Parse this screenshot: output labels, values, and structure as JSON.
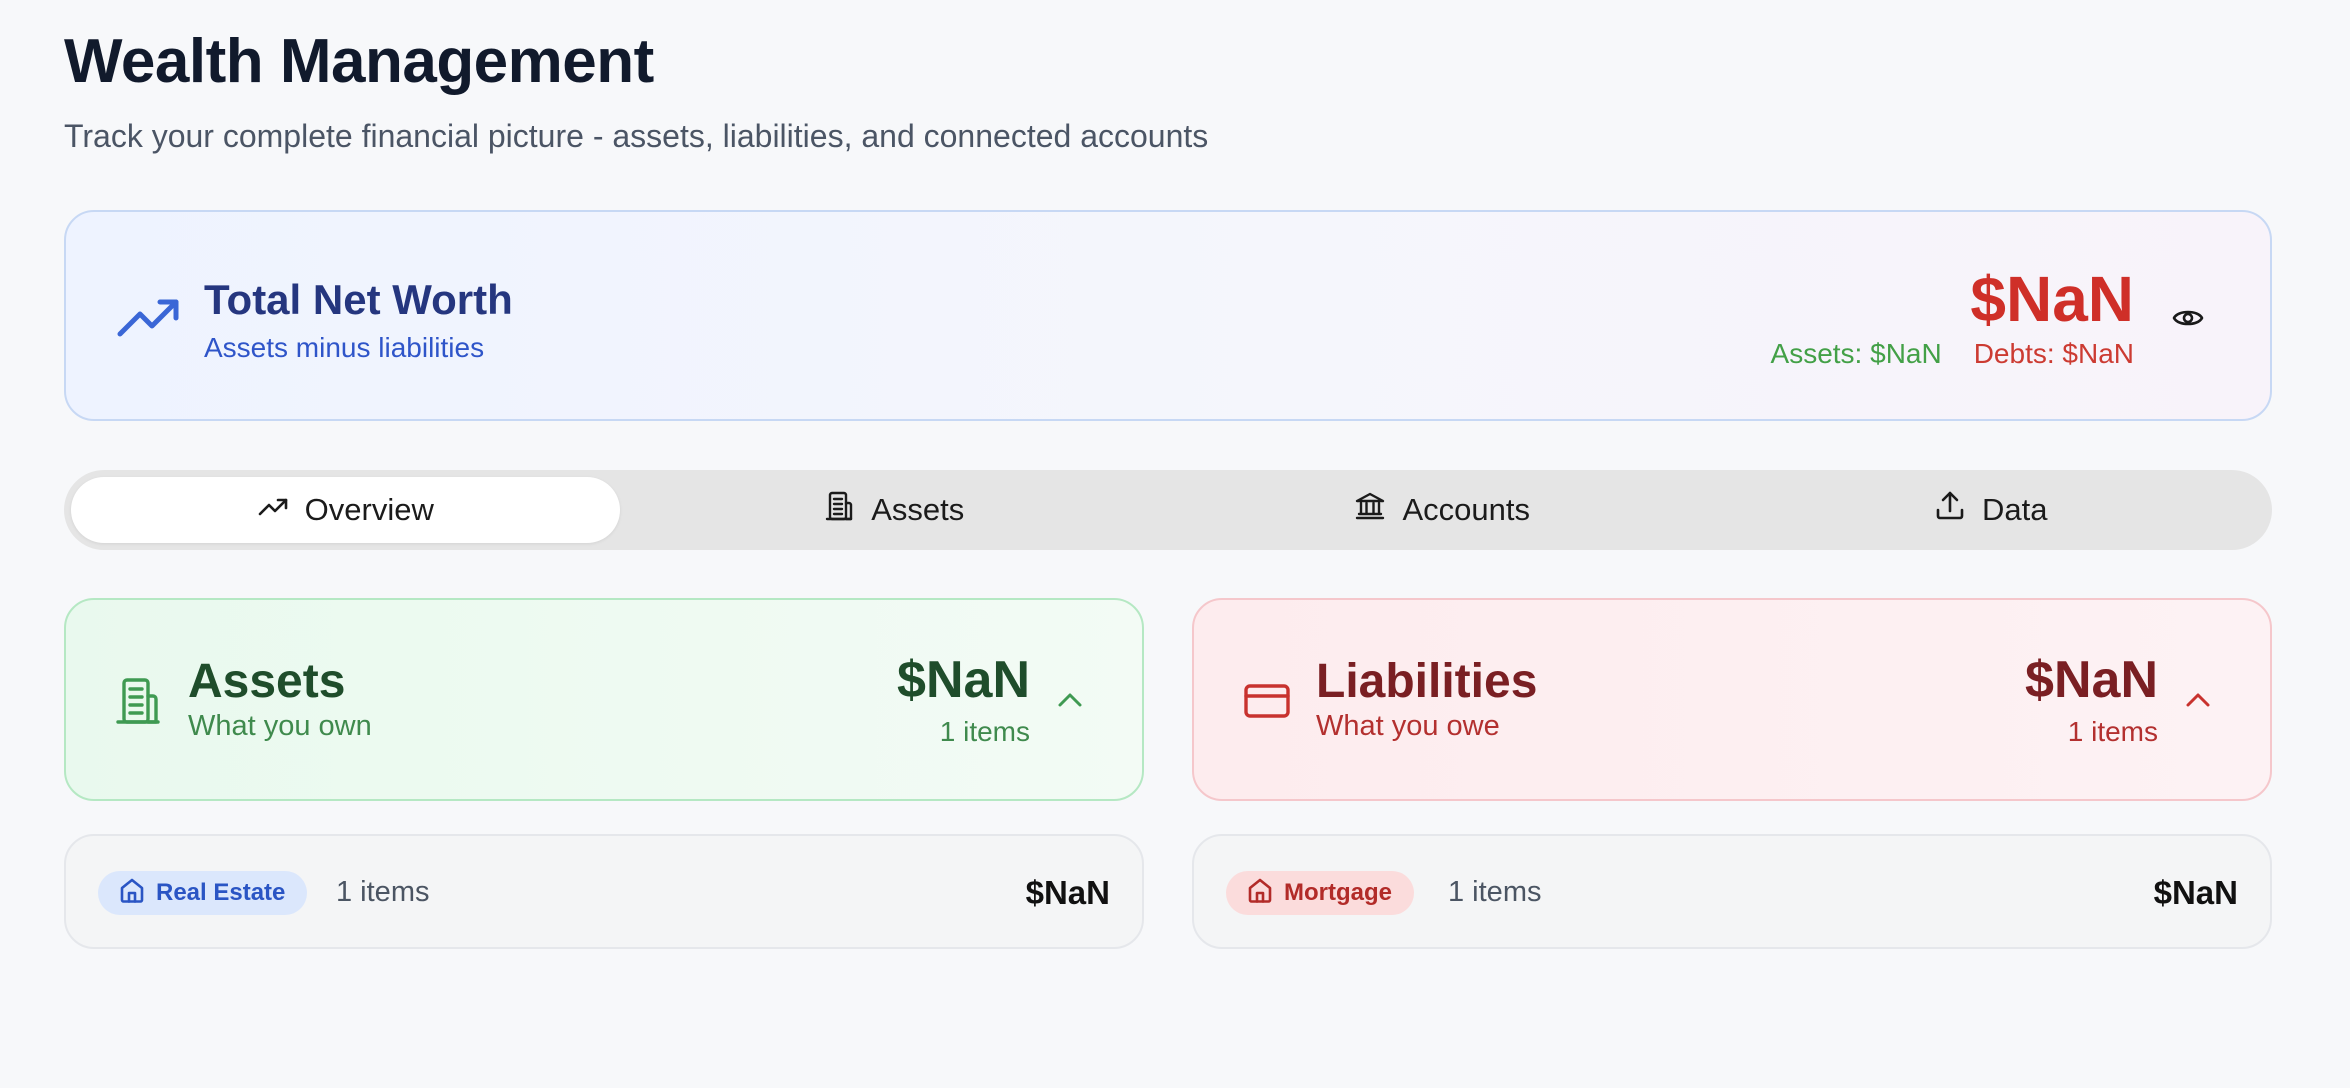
{
  "page": {
    "title": "Wealth Management",
    "subtitle": "Track your complete financial picture - assets, liabilities, and connected accounts"
  },
  "net_worth": {
    "icon": "trending-up-icon",
    "title": "Total Net Worth",
    "subtitle": "Assets minus liabilities",
    "value": "$NaN",
    "assets_label": "Assets: $NaN",
    "debts_label": "Debts: $NaN",
    "toggle_icon": "eye-icon"
  },
  "tabs": [
    {
      "label": "Overview",
      "icon": "trending-up-icon",
      "active": true
    },
    {
      "label": "Assets",
      "icon": "building-icon",
      "active": false
    },
    {
      "label": "Accounts",
      "icon": "bank-icon",
      "active": false
    },
    {
      "label": "Data",
      "icon": "upload-icon",
      "active": false
    }
  ],
  "assets_summary": {
    "icon": "building-icon",
    "title": "Assets",
    "subtitle": "What you own",
    "value": "$NaN",
    "count": "1 items",
    "chevron": "chevron-up-icon"
  },
  "liabilities_summary": {
    "icon": "credit-card-icon",
    "title": "Liabilities",
    "subtitle": "What you owe",
    "value": "$NaN",
    "count": "1 items",
    "chevron": "chevron-up-icon"
  },
  "asset_categories": [
    {
      "label": "Real Estate",
      "icon": "home-icon",
      "count": "1 items",
      "value": "$NaN"
    }
  ],
  "liability_categories": [
    {
      "label": "Mortgage",
      "icon": "home-icon",
      "count": "1 items",
      "value": "$NaN"
    }
  ],
  "colors": {
    "accent_blue": "#2f55c9",
    "asset_green": "#43a047",
    "debt_red": "#cf2f28"
  }
}
